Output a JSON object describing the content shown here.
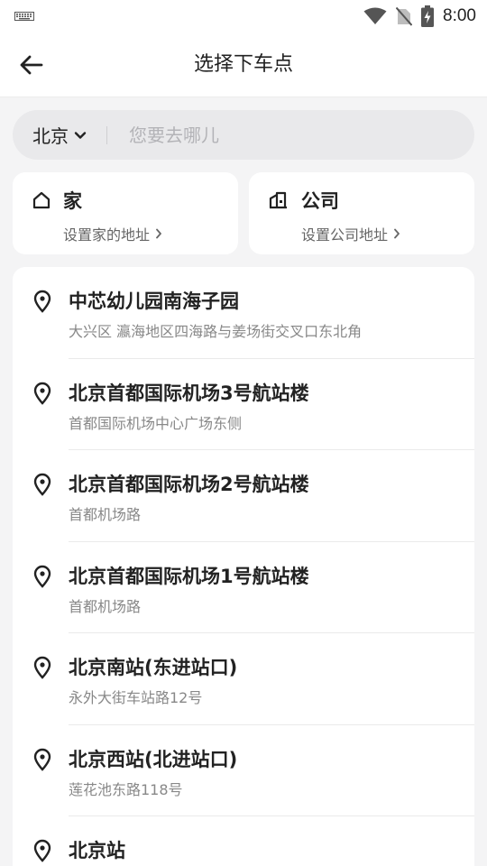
{
  "status_bar": {
    "time": "8:00",
    "icons": [
      "keyboard-icon",
      "wifi-icon",
      "no-sim-icon",
      "battery-charging-icon"
    ]
  },
  "header": {
    "title": "选择下车点",
    "back_icon": "arrow-left-icon"
  },
  "search": {
    "city": "北京",
    "placeholder": "您要去哪儿"
  },
  "shortcuts": {
    "home": {
      "label": "家",
      "sub": "设置家的地址"
    },
    "company": {
      "label": "公司",
      "sub": "设置公司地址"
    }
  },
  "places": [
    {
      "name": "中芯幼儿园南海子园",
      "address": "大兴区 瀛海地区四海路与姜场街交叉口东北角"
    },
    {
      "name": "北京首都国际机场3号航站楼",
      "address": "首都国际机场中心广场东侧"
    },
    {
      "name": "北京首都国际机场2号航站楼",
      "address": "首都机场路"
    },
    {
      "name": "北京首都国际机场1号航站楼",
      "address": "首都机场路"
    },
    {
      "name": "北京南站(东进站口)",
      "address": "永外大街车站路12号"
    },
    {
      "name": "北京西站(北进站口)",
      "address": "莲花池东路118号"
    },
    {
      "name": "北京站",
      "address": ""
    }
  ]
}
